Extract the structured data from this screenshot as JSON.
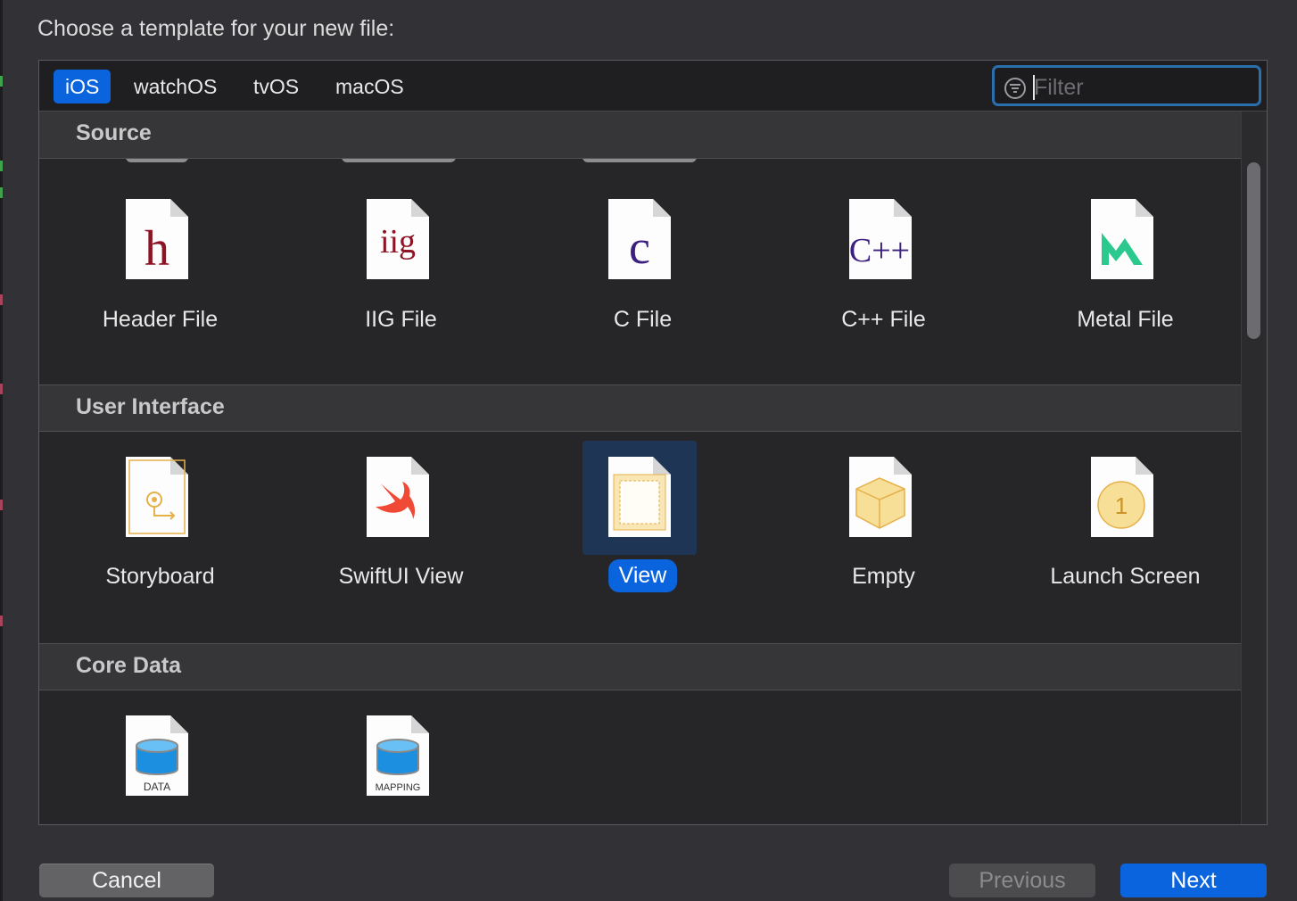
{
  "prompt": "Choose a template for your new file:",
  "platform_tabs": [
    "iOS",
    "watchOS",
    "tvOS",
    "macOS"
  ],
  "selected_platform": "iOS",
  "filter": {
    "placeholder": "Filter",
    "value": ""
  },
  "sections": {
    "source": {
      "title": "Source",
      "items": [
        "Header File",
        "IIG File",
        "C File",
        "C++ File",
        "Metal File"
      ],
      "icon_glyphs": {
        "header": "h",
        "iig": "iig",
        "c": "c",
        "cpp": "C++"
      }
    },
    "user_interface": {
      "title": "User Interface",
      "items": [
        "Storyboard",
        "SwiftUI View",
        "View",
        "Empty",
        "Launch Screen"
      ],
      "selected": "View",
      "launch_glyph": "1"
    },
    "core_data": {
      "title": "Core Data",
      "icon_captions": [
        "DATA",
        "MAPPING"
      ]
    }
  },
  "buttons": {
    "cancel": "Cancel",
    "previous": "Previous",
    "next": "Next"
  },
  "colors": {
    "accent": "#0a64dd",
    "background": "#262629",
    "header": "#363639",
    "selection": "#1f3556"
  }
}
